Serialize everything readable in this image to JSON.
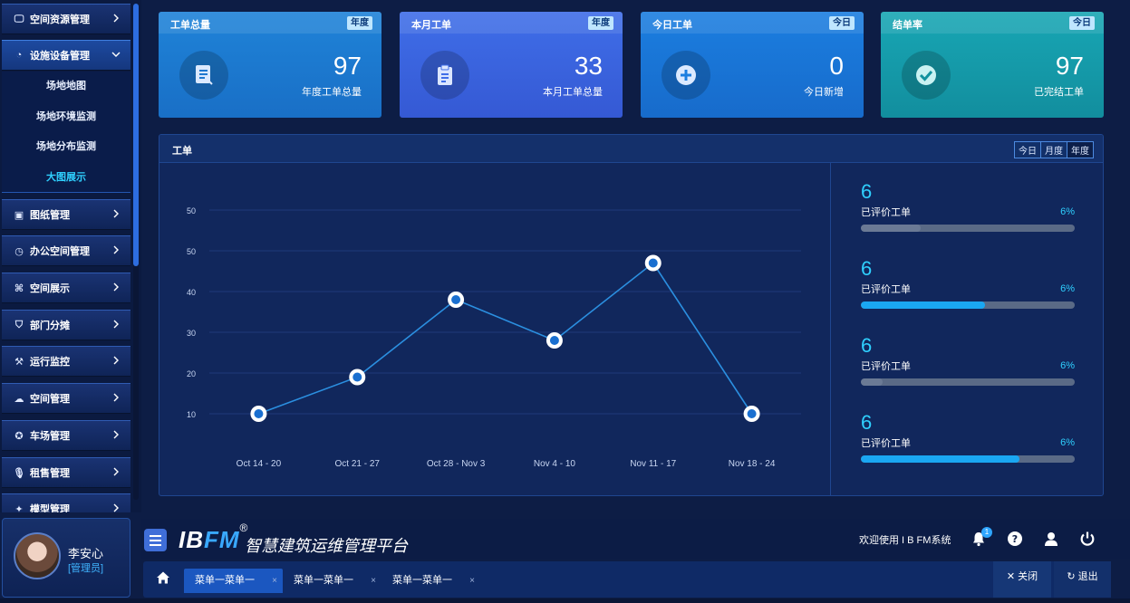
{
  "sidebar": {
    "items": [
      {
        "icon": "monitor-icon",
        "glyph": "🖵",
        "label": "空间资源管理"
      },
      {
        "icon": "pie-chart-icon",
        "glyph": "◔",
        "label": "设施设备管理"
      },
      {
        "icon": "image-icon",
        "glyph": "▣",
        "label": "图纸管理"
      },
      {
        "icon": "clock-icon",
        "glyph": "◷",
        "label": "办公空间管理"
      },
      {
        "icon": "command-icon",
        "glyph": "⌘",
        "label": "空间展示"
      },
      {
        "icon": "basket-icon",
        "glyph": "⛉",
        "label": "部门分摊"
      },
      {
        "icon": "wrench-icon",
        "glyph": "⚒",
        "label": "运行监控"
      },
      {
        "icon": "cloud-icon",
        "glyph": "☁",
        "label": "空间管理"
      },
      {
        "icon": "steering-icon",
        "glyph": "✪",
        "label": "车场管理"
      },
      {
        "icon": "microphone-icon",
        "glyph": "🎙",
        "label": "租售管理"
      },
      {
        "icon": "model-icon",
        "glyph": "✦",
        "label": "模型管理"
      }
    ],
    "submenu": [
      "场地地图",
      "场地环境监测",
      "场地分布监测",
      "大图展示"
    ]
  },
  "user": {
    "name": "李安心",
    "role": "[管理员]"
  },
  "cards": [
    {
      "title": "工单总量",
      "badge": "年度",
      "value": "97",
      "label": "年度工单总量",
      "icon": "document-icon"
    },
    {
      "title": "本月工单",
      "badge": "年度",
      "value": "33",
      "label": "本月工单总量",
      "icon": "clipboard-icon"
    },
    {
      "title": "今日工单",
      "badge": "今日",
      "value": "0",
      "label": "今日新增",
      "icon": "plus-circle-icon"
    },
    {
      "title": "结单率",
      "badge": "今日",
      "value": "97",
      "label": "已完结工单",
      "icon": "check-circle-icon"
    }
  ],
  "work_orders": {
    "title": "工单",
    "tabs": [
      "今日",
      "月度",
      "年度"
    ]
  },
  "chart_data": {
    "type": "line",
    "categories": [
      "Oct 14 - 20",
      "Oct 21 - 27",
      "Oct 28 - Nov 3",
      "Nov 4 - 10",
      "Nov 11 - 17",
      "Nov 18 - 24"
    ],
    "values": [
      10,
      19,
      38,
      28,
      47,
      10
    ],
    "y_ticks": [
      "10",
      "20",
      "30",
      "40",
      "50",
      "50"
    ],
    "ylim": [
      0,
      60
    ],
    "grid": true,
    "color": "#2b8fe0"
  },
  "progress": [
    {
      "value": "6",
      "label": "已评价工单",
      "percent_text": "6%",
      "fill": 0.28,
      "fill_color": "#6b7a95"
    },
    {
      "value": "6",
      "label": "已评价工单",
      "percent_text": "6%",
      "fill": 0.58,
      "fill_color": "#1aa7f2"
    },
    {
      "value": "6",
      "label": "已评价工单",
      "percent_text": "6%",
      "fill": 0.1,
      "fill_color": "#6b7a95"
    },
    {
      "value": "6",
      "label": "已评价工单",
      "percent_text": "6%",
      "fill": 0.74,
      "fill_color": "#1aa7f2"
    }
  ],
  "brand": {
    "logo_ib": "IB",
    "logo_fm": "FM",
    "reg": "®",
    "text": "智慧建筑运维管理平台"
  },
  "header": {
    "welcome": "欢迎使用 I B FM系统",
    "notifications": "1"
  },
  "tabs": [
    {
      "label": "菜单一菜单一",
      "active": true
    },
    {
      "label": "菜单一菜单一",
      "active": false
    },
    {
      "label": "菜单一菜单一",
      "active": false
    }
  ],
  "tab_close": "×",
  "actions": {
    "close": "✕ 关闭",
    "logout": "↻ 退出"
  }
}
